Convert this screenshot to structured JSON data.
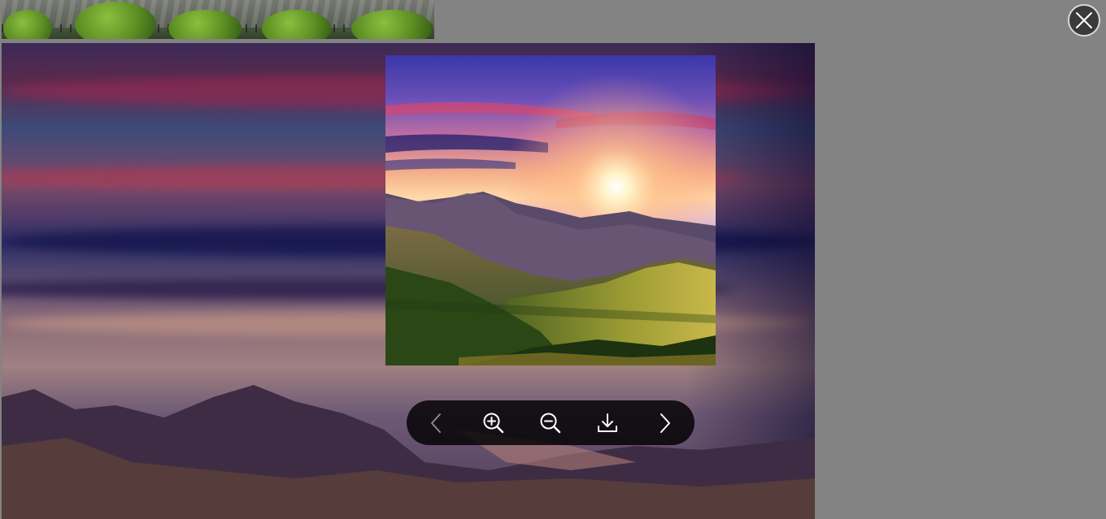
{
  "viewer": {
    "backdrop_color": "#838383",
    "toolbar_color": "#000000",
    "icon_color": "#ffffff",
    "close_button": {
      "icon": "close-icon",
      "border_color": "#d9d9d9"
    },
    "toolbar": [
      {
        "name": "prev-button",
        "icon": "chevron-left-icon",
        "disabled": true
      },
      {
        "name": "zoom-in-button",
        "icon": "zoom-in-icon"
      },
      {
        "name": "zoom-out-button",
        "icon": "zoom-out-icon"
      },
      {
        "name": "download-button",
        "icon": "download-icon"
      },
      {
        "name": "next-button",
        "icon": "chevron-right-icon",
        "disabled": false
      }
    ],
    "images": {
      "current": "mountain-sunrise-photo",
      "background_thumbnail": "garden-pond-photo",
      "backdrop": "mountain-sunrise-blurred"
    }
  }
}
